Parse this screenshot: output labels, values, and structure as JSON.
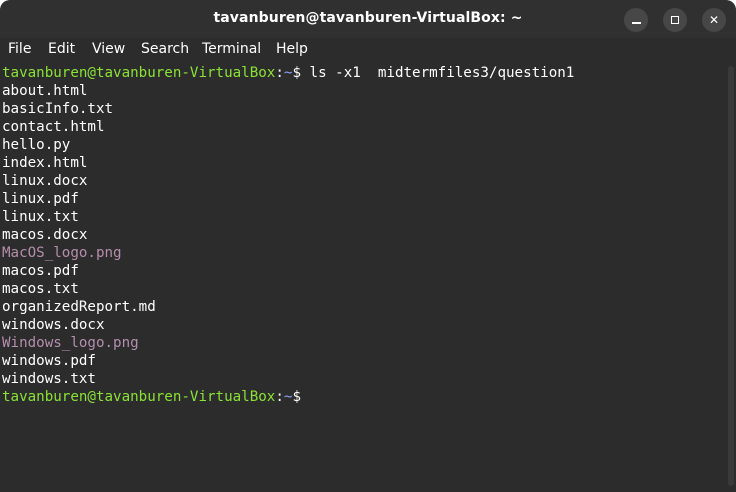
{
  "window": {
    "title": "tavanburen@tavanburen-VirtualBox: ~"
  },
  "menu": {
    "items": [
      "File",
      "Edit",
      "View",
      "Search",
      "Terminal",
      "Help"
    ]
  },
  "terminal": {
    "prompt_user": "tavanburen@tavanburen-VirtualBox",
    "prompt_sep": ":",
    "prompt_path": "~",
    "prompt_symbol": "$",
    "command": " ls -x1  midtermfiles3/question1",
    "files": [
      {
        "name": "about.html",
        "type": "regular"
      },
      {
        "name": "basicInfo.txt",
        "type": "regular"
      },
      {
        "name": "contact.html",
        "type": "regular"
      },
      {
        "name": "hello.py",
        "type": "regular"
      },
      {
        "name": "index.html",
        "type": "regular"
      },
      {
        "name": "linux.docx",
        "type": "regular"
      },
      {
        "name": "linux.pdf",
        "type": "regular"
      },
      {
        "name": "linux.txt",
        "type": "regular"
      },
      {
        "name": "macos.docx",
        "type": "regular"
      },
      {
        "name": "MacOS_logo.png",
        "type": "image"
      },
      {
        "name": "macos.pdf",
        "type": "regular"
      },
      {
        "name": "macos.txt",
        "type": "regular"
      },
      {
        "name": "organizedReport.md",
        "type": "regular"
      },
      {
        "name": "windows.docx",
        "type": "regular"
      },
      {
        "name": "Windows_logo.png",
        "type": "image"
      },
      {
        "name": "windows.pdf",
        "type": "regular"
      },
      {
        "name": "windows.txt",
        "type": "regular"
      }
    ]
  },
  "colors": {
    "prompt_user": "#8ae234",
    "prompt_path": "#8fa0ff",
    "image_file": "#b48ead",
    "background": "#2c2c2c",
    "text": "#ffffff"
  },
  "icons": {
    "minimize": "minimize-icon",
    "maximize": "maximize-icon",
    "close": "close-icon"
  }
}
